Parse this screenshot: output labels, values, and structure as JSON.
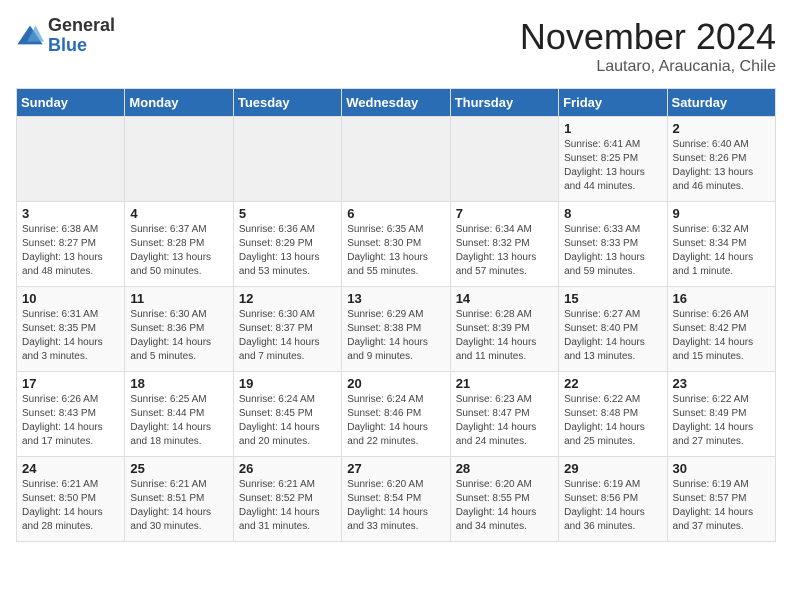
{
  "logo": {
    "general": "General",
    "blue": "Blue"
  },
  "title": {
    "month": "November 2024",
    "location": "Lautaro, Araucania, Chile"
  },
  "weekdays": [
    "Sunday",
    "Monday",
    "Tuesday",
    "Wednesday",
    "Thursday",
    "Friday",
    "Saturday"
  ],
  "weeks": [
    [
      {
        "day": "",
        "info": ""
      },
      {
        "day": "",
        "info": ""
      },
      {
        "day": "",
        "info": ""
      },
      {
        "day": "",
        "info": ""
      },
      {
        "day": "",
        "info": ""
      },
      {
        "day": "1",
        "info": "Sunrise: 6:41 AM\nSunset: 8:25 PM\nDaylight: 13 hours\nand 44 minutes."
      },
      {
        "day": "2",
        "info": "Sunrise: 6:40 AM\nSunset: 8:26 PM\nDaylight: 13 hours\nand 46 minutes."
      }
    ],
    [
      {
        "day": "3",
        "info": "Sunrise: 6:38 AM\nSunset: 8:27 PM\nDaylight: 13 hours\nand 48 minutes."
      },
      {
        "day": "4",
        "info": "Sunrise: 6:37 AM\nSunset: 8:28 PM\nDaylight: 13 hours\nand 50 minutes."
      },
      {
        "day": "5",
        "info": "Sunrise: 6:36 AM\nSunset: 8:29 PM\nDaylight: 13 hours\nand 53 minutes."
      },
      {
        "day": "6",
        "info": "Sunrise: 6:35 AM\nSunset: 8:30 PM\nDaylight: 13 hours\nand 55 minutes."
      },
      {
        "day": "7",
        "info": "Sunrise: 6:34 AM\nSunset: 8:32 PM\nDaylight: 13 hours\nand 57 minutes."
      },
      {
        "day": "8",
        "info": "Sunrise: 6:33 AM\nSunset: 8:33 PM\nDaylight: 13 hours\nand 59 minutes."
      },
      {
        "day": "9",
        "info": "Sunrise: 6:32 AM\nSunset: 8:34 PM\nDaylight: 14 hours\nand 1 minute."
      }
    ],
    [
      {
        "day": "10",
        "info": "Sunrise: 6:31 AM\nSunset: 8:35 PM\nDaylight: 14 hours\nand 3 minutes."
      },
      {
        "day": "11",
        "info": "Sunrise: 6:30 AM\nSunset: 8:36 PM\nDaylight: 14 hours\nand 5 minutes."
      },
      {
        "day": "12",
        "info": "Sunrise: 6:30 AM\nSunset: 8:37 PM\nDaylight: 14 hours\nand 7 minutes."
      },
      {
        "day": "13",
        "info": "Sunrise: 6:29 AM\nSunset: 8:38 PM\nDaylight: 14 hours\nand 9 minutes."
      },
      {
        "day": "14",
        "info": "Sunrise: 6:28 AM\nSunset: 8:39 PM\nDaylight: 14 hours\nand 11 minutes."
      },
      {
        "day": "15",
        "info": "Sunrise: 6:27 AM\nSunset: 8:40 PM\nDaylight: 14 hours\nand 13 minutes."
      },
      {
        "day": "16",
        "info": "Sunrise: 6:26 AM\nSunset: 8:42 PM\nDaylight: 14 hours\nand 15 minutes."
      }
    ],
    [
      {
        "day": "17",
        "info": "Sunrise: 6:26 AM\nSunset: 8:43 PM\nDaylight: 14 hours\nand 17 minutes."
      },
      {
        "day": "18",
        "info": "Sunrise: 6:25 AM\nSunset: 8:44 PM\nDaylight: 14 hours\nand 18 minutes."
      },
      {
        "day": "19",
        "info": "Sunrise: 6:24 AM\nSunset: 8:45 PM\nDaylight: 14 hours\nand 20 minutes."
      },
      {
        "day": "20",
        "info": "Sunrise: 6:24 AM\nSunset: 8:46 PM\nDaylight: 14 hours\nand 22 minutes."
      },
      {
        "day": "21",
        "info": "Sunrise: 6:23 AM\nSunset: 8:47 PM\nDaylight: 14 hours\nand 24 minutes."
      },
      {
        "day": "22",
        "info": "Sunrise: 6:22 AM\nSunset: 8:48 PM\nDaylight: 14 hours\nand 25 minutes."
      },
      {
        "day": "23",
        "info": "Sunrise: 6:22 AM\nSunset: 8:49 PM\nDaylight: 14 hours\nand 27 minutes."
      }
    ],
    [
      {
        "day": "24",
        "info": "Sunrise: 6:21 AM\nSunset: 8:50 PM\nDaylight: 14 hours\nand 28 minutes."
      },
      {
        "day": "25",
        "info": "Sunrise: 6:21 AM\nSunset: 8:51 PM\nDaylight: 14 hours\nand 30 minutes."
      },
      {
        "day": "26",
        "info": "Sunrise: 6:21 AM\nSunset: 8:52 PM\nDaylight: 14 hours\nand 31 minutes."
      },
      {
        "day": "27",
        "info": "Sunrise: 6:20 AM\nSunset: 8:54 PM\nDaylight: 14 hours\nand 33 minutes."
      },
      {
        "day": "28",
        "info": "Sunrise: 6:20 AM\nSunset: 8:55 PM\nDaylight: 14 hours\nand 34 minutes."
      },
      {
        "day": "29",
        "info": "Sunrise: 6:19 AM\nSunset: 8:56 PM\nDaylight: 14 hours\nand 36 minutes."
      },
      {
        "day": "30",
        "info": "Sunrise: 6:19 AM\nSunset: 8:57 PM\nDaylight: 14 hours\nand 37 minutes."
      }
    ]
  ]
}
